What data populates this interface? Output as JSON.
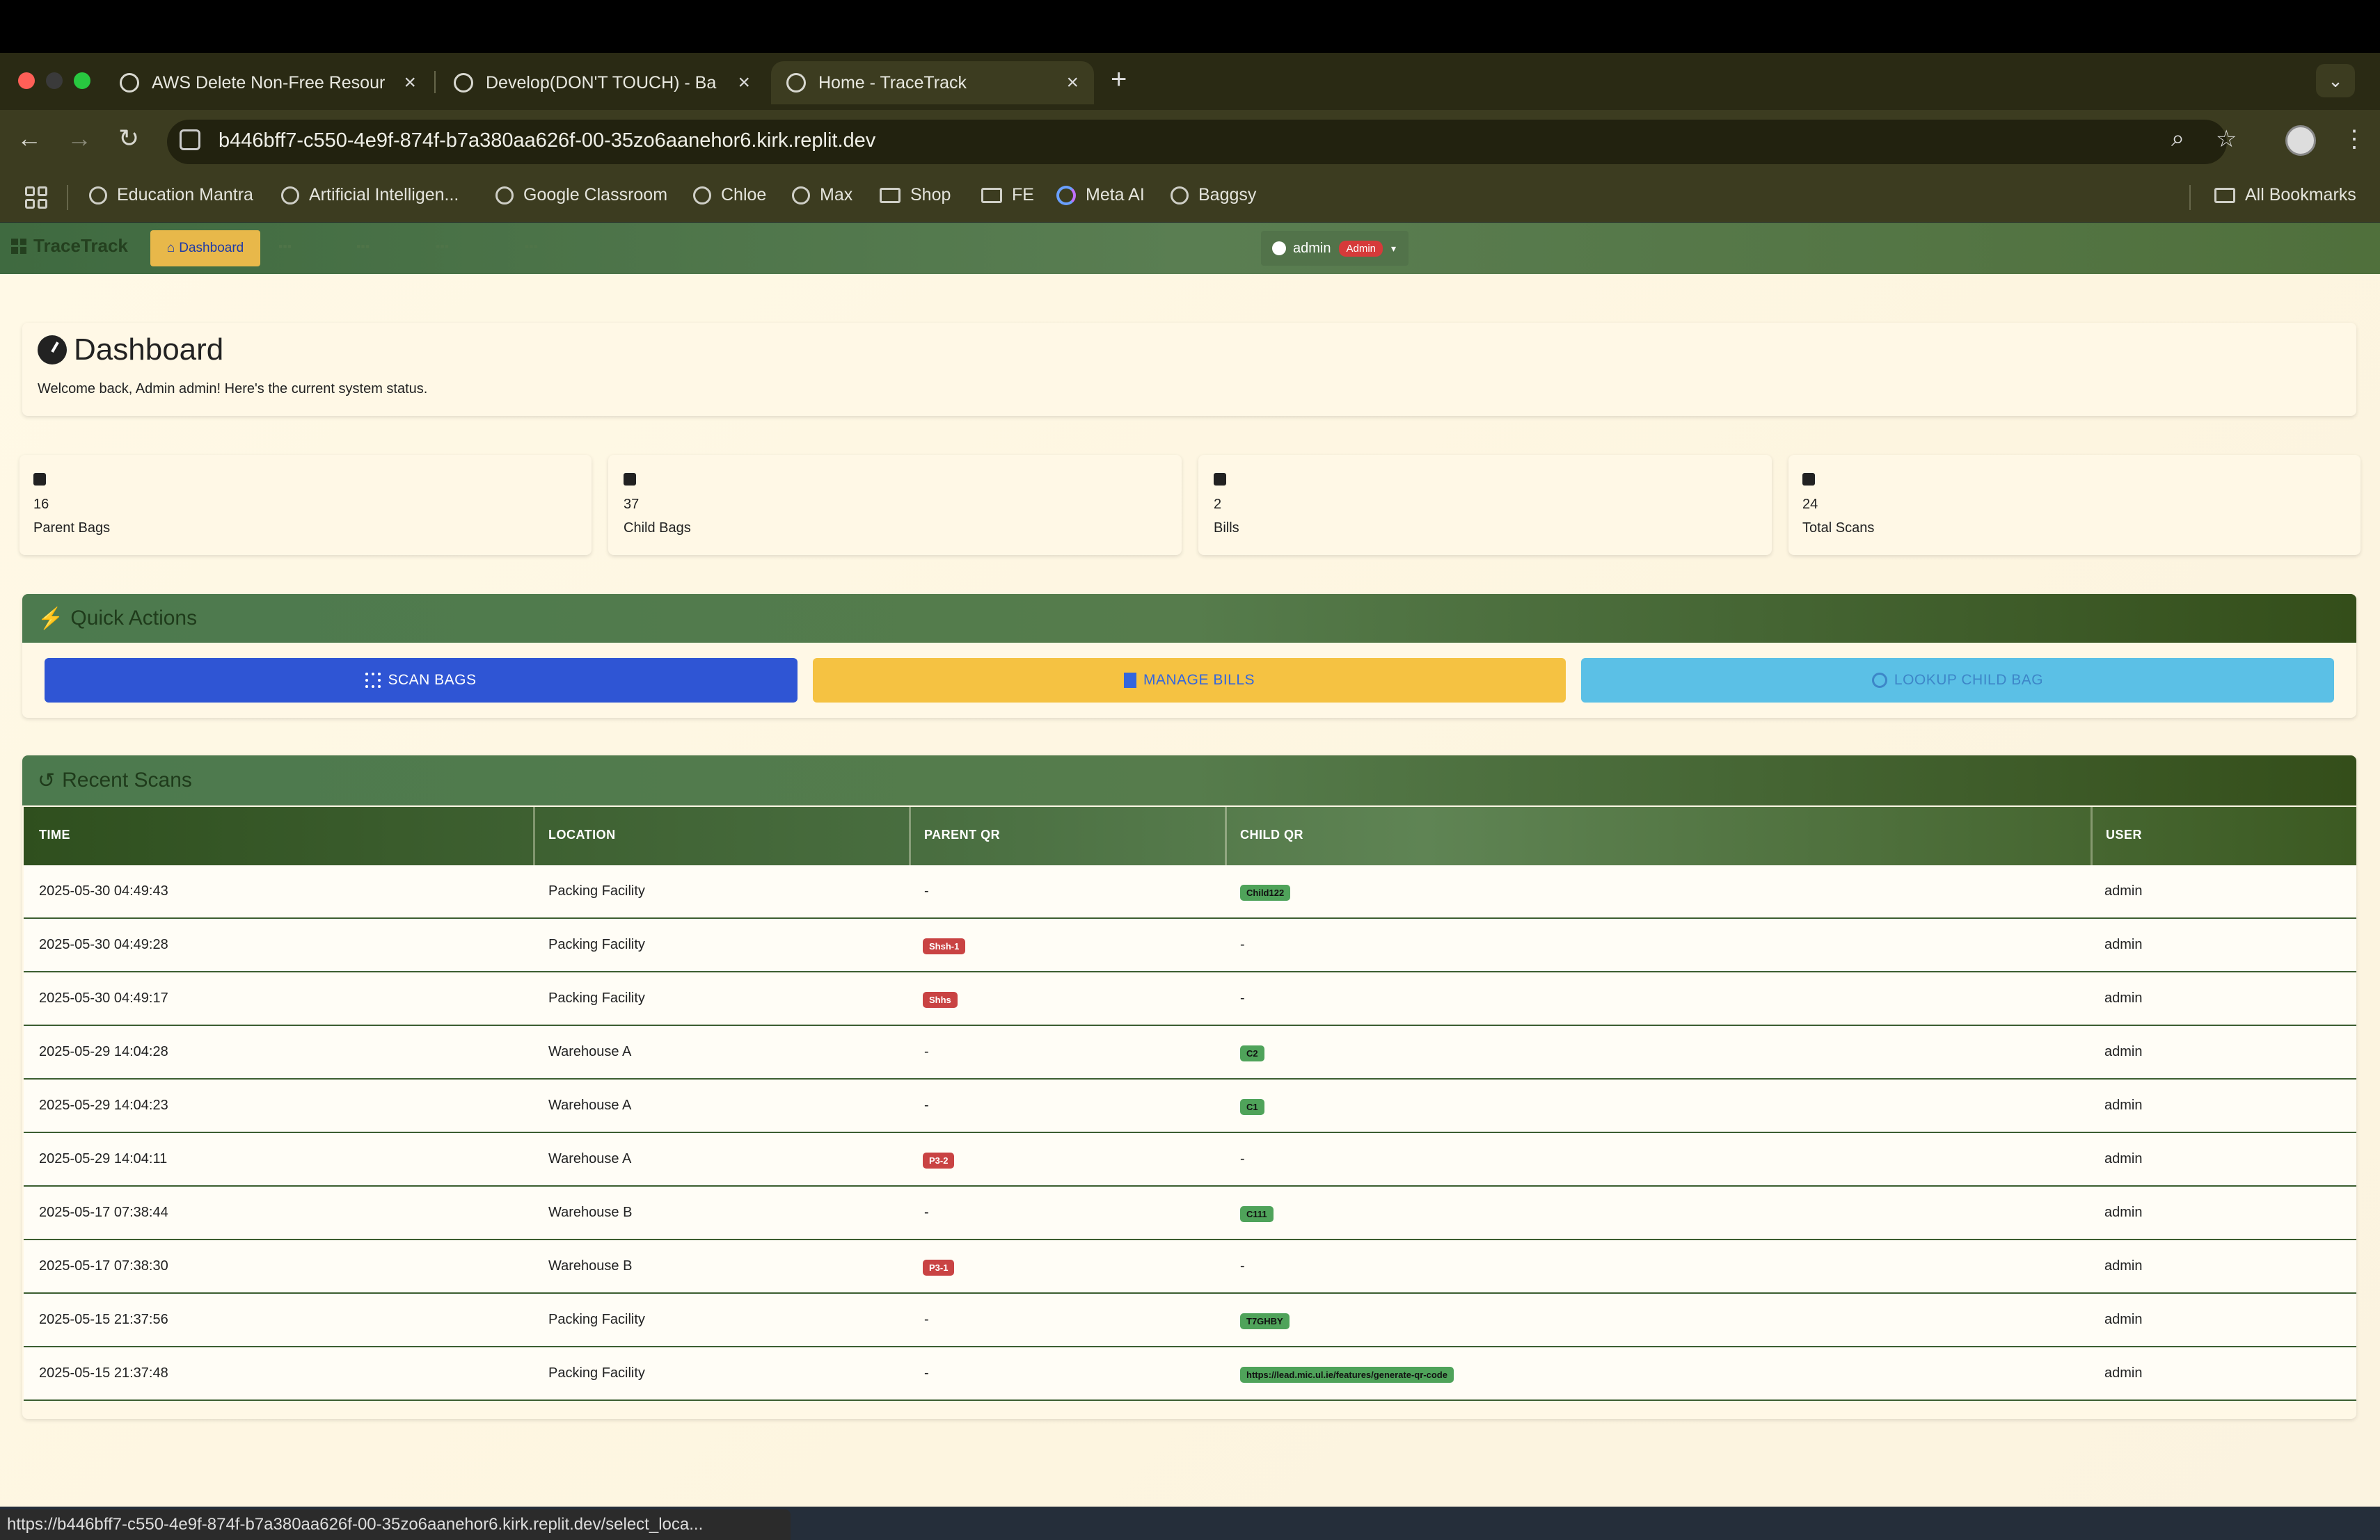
{
  "browser": {
    "tabs": [
      {
        "title": "AWS Delete Non-Free Resour"
      },
      {
        "title": "Develop(DON'T TOUCH) - Ba"
      },
      {
        "title": "Home - TraceTrack"
      }
    ],
    "url": "b446bff7-c550-4e9f-874f-b7a380aa626f-00-35zo6aanehor6.kirk.replit.dev",
    "bookmarks": [
      "Education Mantra",
      "Artificial Intelligen...",
      "Google Classroom",
      "Chloe",
      "Max",
      "Shop",
      "FE",
      "Meta AI",
      "Baggsy"
    ],
    "all_bookmarks": "All Bookmarks",
    "status_url": "https://b446bff7-c550-4e9f-874f-b7a380aa626f-00-35zo6aanehor6.kirk.replit.dev/select_loca..."
  },
  "app": {
    "brand": "TraceTrack",
    "nav_active": "Dashboard",
    "user": "admin",
    "role_badge": "Admin"
  },
  "dashboard": {
    "title": "Dashboard",
    "welcome": "Welcome back, Admin admin! Here's the current system status."
  },
  "stats": [
    {
      "value": "16",
      "label": "Parent Bags"
    },
    {
      "value": "37",
      "label": "Child Bags"
    },
    {
      "value": "2",
      "label": "Bills"
    },
    {
      "value": "24",
      "label": "Total Scans"
    }
  ],
  "quick_actions": {
    "title": "Quick Actions",
    "scan": "SCAN BAGS",
    "bills": "MANAGE BILLS",
    "lookup": "LOOKUP CHILD BAG"
  },
  "recent": {
    "title": "Recent Scans",
    "headers": [
      "TIME",
      "LOCATION",
      "PARENT QR",
      "CHILD QR",
      "USER"
    ],
    "rows": [
      {
        "time": "2025-05-30 04:49:43",
        "location": "Packing Facility",
        "parent": "-",
        "child": "Child122",
        "user": "admin"
      },
      {
        "time": "2025-05-30 04:49:28",
        "location": "Packing Facility",
        "parent": "Shsh-1",
        "child": "-",
        "user": "admin"
      },
      {
        "time": "2025-05-30 04:49:17",
        "location": "Packing Facility",
        "parent": "Shhs",
        "child": "-",
        "user": "admin"
      },
      {
        "time": "2025-05-29 14:04:28",
        "location": "Warehouse A",
        "parent": "-",
        "child": "C2",
        "user": "admin"
      },
      {
        "time": "2025-05-29 14:04:23",
        "location": "Warehouse A",
        "parent": "-",
        "child": "C1",
        "user": "admin"
      },
      {
        "time": "2025-05-29 14:04:11",
        "location": "Warehouse A",
        "parent": "P3-2",
        "child": "-",
        "user": "admin"
      },
      {
        "time": "2025-05-17 07:38:44",
        "location": "Warehouse B",
        "parent": "-",
        "child": "C111",
        "user": "admin"
      },
      {
        "time": "2025-05-17 07:38:30",
        "location": "Warehouse B",
        "parent": "P3-1",
        "child": "-",
        "user": "admin"
      },
      {
        "time": "2025-05-15 21:37:56",
        "location": "Packing Facility",
        "parent": "-",
        "child": "T7GHBY",
        "user": "admin"
      },
      {
        "time": "2025-05-15 21:37:48",
        "location": "Packing Facility",
        "parent": "-",
        "child": "https://lead.mic.ul.ie/features/generate-qr-code",
        "user": "admin"
      }
    ]
  },
  "colors": {
    "scan_button": "#2f55d4",
    "bills_button": "#f5c242",
    "lookup_button": "#5bc0e6",
    "parent_badge": "#c94343",
    "child_badge": "#4fa35a"
  }
}
